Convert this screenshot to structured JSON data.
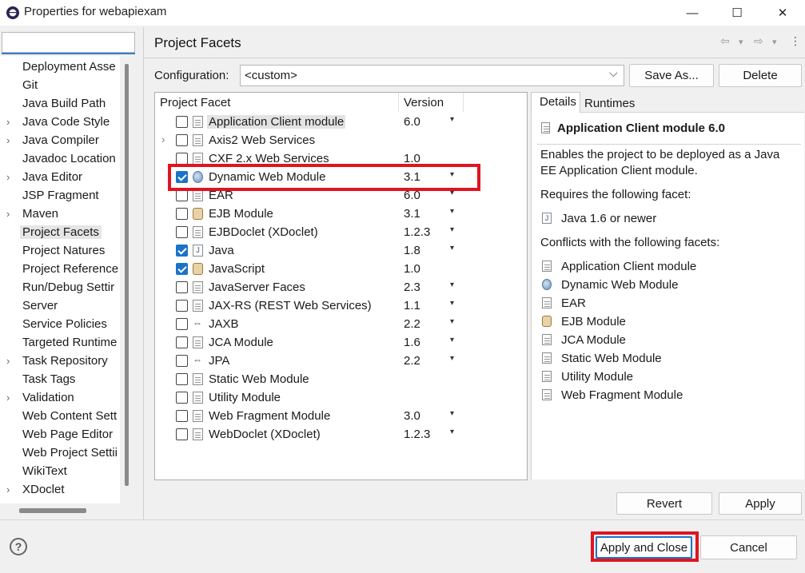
{
  "window": {
    "title": "Properties for webapiexam",
    "minimize": "—",
    "maximize": "☐",
    "close": "✕"
  },
  "nav": {
    "filter_placeholder": "",
    "items": [
      {
        "label": "Deployment Asse",
        "expandable": false
      },
      {
        "label": "Git",
        "expandable": false
      },
      {
        "label": "Java Build Path",
        "expandable": false
      },
      {
        "label": "Java Code Style",
        "expandable": true
      },
      {
        "label": "Java Compiler",
        "expandable": true
      },
      {
        "label": "Javadoc Location",
        "expandable": false
      },
      {
        "label": "Java Editor",
        "expandable": true
      },
      {
        "label": "JSP Fragment",
        "expandable": false
      },
      {
        "label": "Maven",
        "expandable": true
      },
      {
        "label": "Project Facets",
        "expandable": false,
        "selected": true
      },
      {
        "label": "Project Natures",
        "expandable": false
      },
      {
        "label": "Project Reference",
        "expandable": false
      },
      {
        "label": "Run/Debug Settir",
        "expandable": false
      },
      {
        "label": "Server",
        "expandable": false
      },
      {
        "label": "Service Policies",
        "expandable": false
      },
      {
        "label": "Targeted Runtime",
        "expandable": false
      },
      {
        "label": "Task Repository",
        "expandable": true
      },
      {
        "label": "Task Tags",
        "expandable": false
      },
      {
        "label": "Validation",
        "expandable": true
      },
      {
        "label": "Web Content Sett",
        "expandable": false
      },
      {
        "label": "Web Page Editor",
        "expandable": false
      },
      {
        "label": "Web Project Settii",
        "expandable": false
      },
      {
        "label": "WikiText",
        "expandable": false
      },
      {
        "label": "XDoclet",
        "expandable": true
      }
    ]
  },
  "page": {
    "title": "Project Facets",
    "back_icon": "⇦",
    "forward_icon": "⇨",
    "dropdown_icon": "▾",
    "menu_icon": "⋮"
  },
  "config": {
    "label": "Configuration:",
    "value": "<custom>",
    "save_as": "Save As...",
    "delete": "Delete"
  },
  "facets": {
    "col_facet": "Project Facet",
    "col_version": "Version",
    "rows": [
      {
        "name": "Application Client module",
        "version": "6.0",
        "checked": false,
        "icon": "doc",
        "dropdown": true,
        "highlighted": true,
        "expandable": false
      },
      {
        "name": "Axis2 Web Services",
        "version": "",
        "checked": false,
        "icon": "doc",
        "dropdown": false,
        "expandable": true
      },
      {
        "name": "CXF 2.x Web Services",
        "version": "1.0",
        "checked": false,
        "icon": "doc",
        "dropdown": false,
        "expandable": false
      },
      {
        "name": "Dynamic Web Module",
        "version": "3.1",
        "checked": true,
        "icon": "globe",
        "dropdown": true,
        "expandable": false
      },
      {
        "name": "EAR",
        "version": "6.0",
        "checked": false,
        "icon": "doc",
        "dropdown": true,
        "expandable": false
      },
      {
        "name": "EJB Module",
        "version": "3.1",
        "checked": false,
        "icon": "bean",
        "dropdown": true,
        "expandable": false
      },
      {
        "name": "EJBDoclet (XDoclet)",
        "version": "1.2.3",
        "checked": false,
        "icon": "doc",
        "dropdown": true,
        "expandable": false
      },
      {
        "name": "Java",
        "version": "1.8",
        "checked": true,
        "icon": "jar",
        "dropdown": true,
        "expandable": false
      },
      {
        "name": "JavaScript",
        "version": "1.0",
        "checked": true,
        "icon": "bean",
        "dropdown": false,
        "expandable": false
      },
      {
        "name": "JavaServer Faces",
        "version": "2.3",
        "checked": false,
        "icon": "doc",
        "dropdown": true,
        "expandable": false
      },
      {
        "name": "JAX-RS (REST Web Services)",
        "version": "1.1",
        "checked": false,
        "icon": "doc",
        "dropdown": true,
        "expandable": false
      },
      {
        "name": "JAXB",
        "version": "2.2",
        "checked": false,
        "icon": "arrows",
        "dropdown": true,
        "expandable": false
      },
      {
        "name": "JCA Module",
        "version": "1.6",
        "checked": false,
        "icon": "doc",
        "dropdown": true,
        "expandable": false
      },
      {
        "name": "JPA",
        "version": "2.2",
        "checked": false,
        "icon": "arrows",
        "dropdown": true,
        "expandable": false
      },
      {
        "name": "Static Web Module",
        "version": "",
        "checked": false,
        "icon": "doc",
        "dropdown": false,
        "expandable": false
      },
      {
        "name": "Utility Module",
        "version": "",
        "checked": false,
        "icon": "doc",
        "dropdown": false,
        "expandable": false
      },
      {
        "name": "Web Fragment Module",
        "version": "3.0",
        "checked": false,
        "icon": "doc",
        "dropdown": true,
        "expandable": false
      },
      {
        "name": "WebDoclet (XDoclet)",
        "version": "1.2.3",
        "checked": false,
        "icon": "doc",
        "dropdown": true,
        "expandable": false
      }
    ]
  },
  "details": {
    "tab_details": "Details",
    "tab_runtimes": "Runtimes",
    "title": "Application Client module 6.0",
    "description_line1": "Enables the project to be deployed as a Java",
    "description_line2": "EE Application Client module.",
    "requires_heading": "Requires the following facet:",
    "requires": [
      {
        "label": "Java 1.6 or newer",
        "icon": "jar"
      }
    ],
    "conflicts_heading": "Conflicts with the following facets:",
    "conflicts": [
      {
        "label": "Application Client module",
        "icon": "doc"
      },
      {
        "label": "Dynamic Web Module",
        "icon": "globe"
      },
      {
        "label": "EAR",
        "icon": "doc"
      },
      {
        "label": "EJB Module",
        "icon": "bean"
      },
      {
        "label": "JCA Module",
        "icon": "doc"
      },
      {
        "label": "Static Web Module",
        "icon": "doc"
      },
      {
        "label": "Utility Module",
        "icon": "doc"
      },
      {
        "label": "Web Fragment Module",
        "icon": "doc"
      }
    ]
  },
  "buttons": {
    "revert": "Revert",
    "apply": "Apply",
    "apply_and_close": "Apply and Close",
    "cancel": "Cancel",
    "help": "?"
  },
  "colors": {
    "annotation": "#e0141f",
    "check_blue": "#1a73c8"
  }
}
